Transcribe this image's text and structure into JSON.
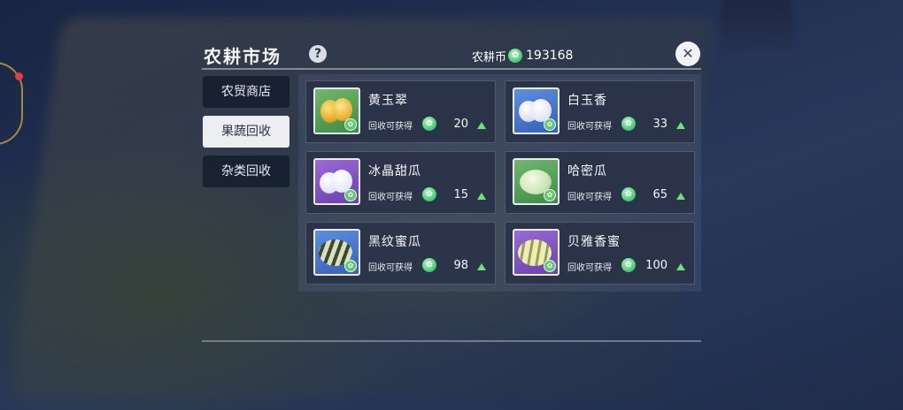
{
  "header": {
    "title": "农耕市场",
    "help_icon": "?",
    "coin_label": "农耕币",
    "coin_value": "193168",
    "close_icon": "✕"
  },
  "tabs": [
    {
      "label": "农贸商店",
      "active": false
    },
    {
      "label": "果蔬回收",
      "active": true
    },
    {
      "label": "杂类回收",
      "active": false
    }
  ],
  "items": [
    {
      "name": "黄玉翠",
      "reward_label": "回收可获得",
      "value": "20",
      "bg": "green",
      "icon": "yellow-melon-icon"
    },
    {
      "name": "白玉香",
      "reward_label": "回收可获得",
      "value": "33",
      "bg": "blue",
      "icon": "white-melon-icon"
    },
    {
      "name": "冰晶甜瓜",
      "reward_label": "回收可获得",
      "value": "15",
      "bg": "purple",
      "icon": "crystal-melon-icon"
    },
    {
      "name": "哈密瓜",
      "reward_label": "回收可获得",
      "value": "65",
      "bg": "green",
      "icon": "hami-melon-icon"
    },
    {
      "name": "黑纹蜜瓜",
      "reward_label": "回收可获得",
      "value": "98",
      "bg": "blue",
      "icon": "black-striped-melon-icon"
    },
    {
      "name": "贝雅香蜜",
      "reward_label": "回收可获得",
      "value": "100",
      "bg": "purple",
      "icon": "beiya-melon-icon"
    }
  ],
  "colors": {
    "accent_green": "#6fe07a",
    "active_tab": "#eceef2",
    "card_bg": "#2a3248"
  }
}
